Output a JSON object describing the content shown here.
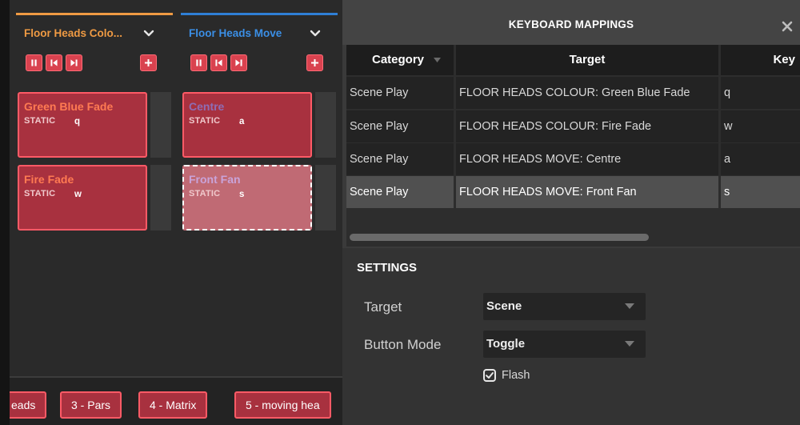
{
  "columns": [
    {
      "title": "Floor Heads Colo...",
      "accent": "#ef9a43",
      "title_color": "#ef9a43",
      "scenes": [
        {
          "name": "Green Blue Fade",
          "type": "STATIC",
          "key": "q",
          "name_color": "#ff7a52"
        },
        {
          "name": "Fire Fade",
          "type": "STATIC",
          "key": "w",
          "name_color": "#ff7a52"
        }
      ]
    },
    {
      "title": "Floor Heads Move",
      "accent": "#2f7fd6",
      "title_color": "#3b8fe6",
      "scenes": [
        {
          "name": "Centre",
          "type": "STATIC",
          "key": "a",
          "name_color": "#8e6db5"
        },
        {
          "name": "Front Fan",
          "type": "STATIC",
          "key": "s",
          "name_color": "#c9a3d9"
        }
      ]
    }
  ],
  "scene_tabs": [
    "eads",
    "3 - Pars",
    "4 - Matrix",
    "5 - moving hea"
  ],
  "dialog": {
    "title": "KEYBOARD MAPPINGS",
    "table": {
      "headers": [
        "Category",
        "Target",
        "Key"
      ],
      "rows": [
        [
          "Scene Play",
          "FLOOR HEADS COLOUR: Green Blue Fade",
          "q"
        ],
        [
          "Scene Play",
          "FLOOR HEADS COLOUR: Fire Fade",
          "w"
        ],
        [
          "Scene Play",
          "FLOOR HEADS MOVE: Centre",
          "a"
        ],
        [
          "Scene Play",
          "FLOOR HEADS MOVE: Front Fan",
          "s"
        ]
      ],
      "selected_row": 3
    },
    "settings": {
      "title": "SETTINGS",
      "target_label": "Target",
      "target_value": "Scene",
      "mode_label": "Button Mode",
      "mode_value": "Toggle",
      "flash_label": "Flash",
      "flash_checked": true
    }
  }
}
